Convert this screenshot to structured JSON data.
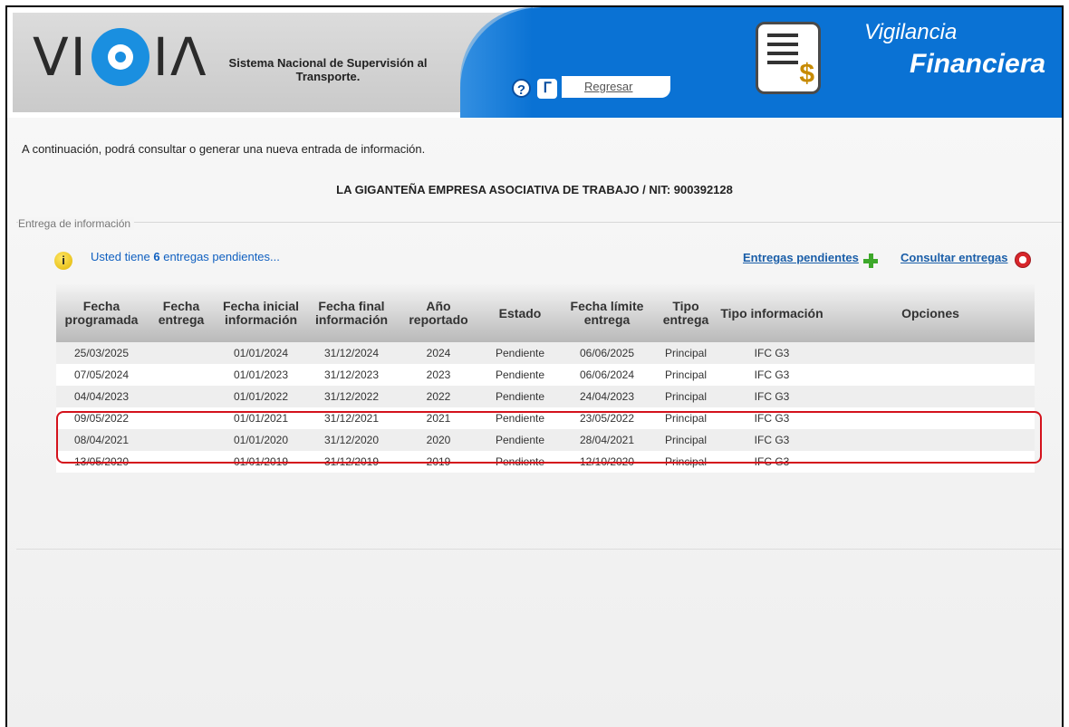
{
  "header": {
    "logo_text_left": "VI",
    "logo_text_right": "IΛ",
    "system_name": "Sistema Nacional de Supervisión al Transporte.",
    "help_icon": "help-icon",
    "back_icon_glyph": "ᒥ",
    "back_label": "Regresar",
    "module_title_line1": "Vigilancia",
    "module_title_line2": "Financiera",
    "module_icon": "document-dollar-icon"
  },
  "content": {
    "intro": "A continuación, podrá consultar o generar una nueva entrada de información.",
    "company": "LA GIGANTEÑA EMPRESA ASOCIATIVA DE TRABAJO / NIT: 900392128",
    "fieldset_legend": "Entrega de información",
    "pending_prefix": "Usted tiene ",
    "pending_count": "6",
    "pending_suffix": " entregas pendientes...",
    "pending_link": "Entregas pendientes",
    "consult_link": "Consultar entregas"
  },
  "table": {
    "headers": [
      "Fecha programada",
      "Fecha entrega",
      "Fecha inicial información",
      "Fecha final información",
      "Año reportado",
      "Estado",
      "Fecha límite entrega",
      "Tipo entrega",
      "Tipo información",
      "Opciones"
    ],
    "rows": [
      [
        "25/03/2025",
        "",
        "01/01/2024",
        "31/12/2024",
        "2024",
        "Pendiente",
        "06/06/2025",
        "Principal",
        "IFC G3",
        ""
      ],
      [
        "07/05/2024",
        "",
        "01/01/2023",
        "31/12/2023",
        "2023",
        "Pendiente",
        "06/06/2024",
        "Principal",
        "IFC G3",
        ""
      ],
      [
        "04/04/2023",
        "",
        "01/01/2022",
        "31/12/2022",
        "2022",
        "Pendiente",
        "24/04/2023",
        "Principal",
        "IFC G3",
        ""
      ],
      [
        "09/05/2022",
        "",
        "01/01/2021",
        "31/12/2021",
        "2021",
        "Pendiente",
        "23/05/2022",
        "Principal",
        "IFC G3",
        ""
      ],
      [
        "08/04/2021",
        "",
        "01/01/2020",
        "31/12/2020",
        "2020",
        "Pendiente",
        "28/04/2021",
        "Principal",
        "IFC G3",
        ""
      ],
      [
        "13/05/2020",
        "",
        "01/01/2019",
        "31/12/2019",
        "2019",
        "Pendiente",
        "12/10/2020",
        "Principal",
        "IFC G3",
        ""
      ]
    ],
    "highlighted_rows": [
      3,
      4
    ]
  },
  "colors": {
    "header_blue": "#0a72d4",
    "link_blue": "#1a5ea8",
    "highlight_red": "#d4121c",
    "plus_green": "#3da82a"
  }
}
